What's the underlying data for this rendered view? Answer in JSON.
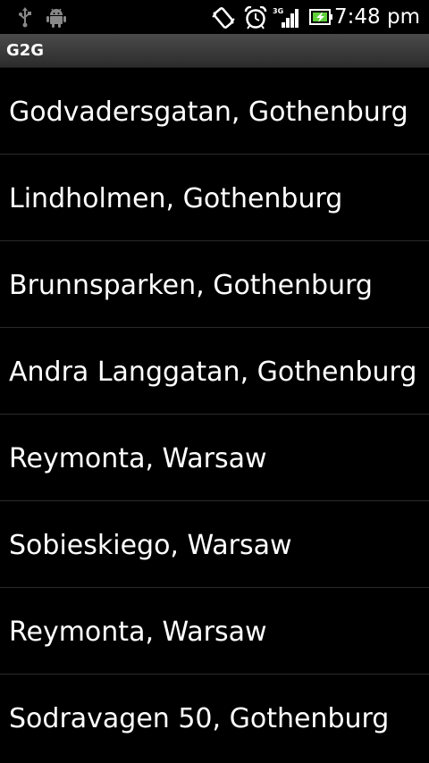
{
  "status_bar": {
    "time": "7:48 pm",
    "network_label": "3G",
    "icons": [
      "usb-icon",
      "android-debug-icon",
      "vibrate-icon",
      "alarm-clock-icon",
      "signal-3g-icon",
      "battery-charging-icon"
    ]
  },
  "title_bar": {
    "title": "G2G"
  },
  "locations": [
    {
      "label": "Godvadersgatan, Gothenburg"
    },
    {
      "label": "Lindholmen, Gothenburg"
    },
    {
      "label": "Brunnsparken, Gothenburg"
    },
    {
      "label": "Andra Langgatan, Gothenburg"
    },
    {
      "label": "Reymonta, Warsaw"
    },
    {
      "label": "Sobieskiego, Warsaw"
    },
    {
      "label": "Reymonta, Warsaw"
    },
    {
      "label": "Sodravagen 50, Gothenburg"
    }
  ]
}
